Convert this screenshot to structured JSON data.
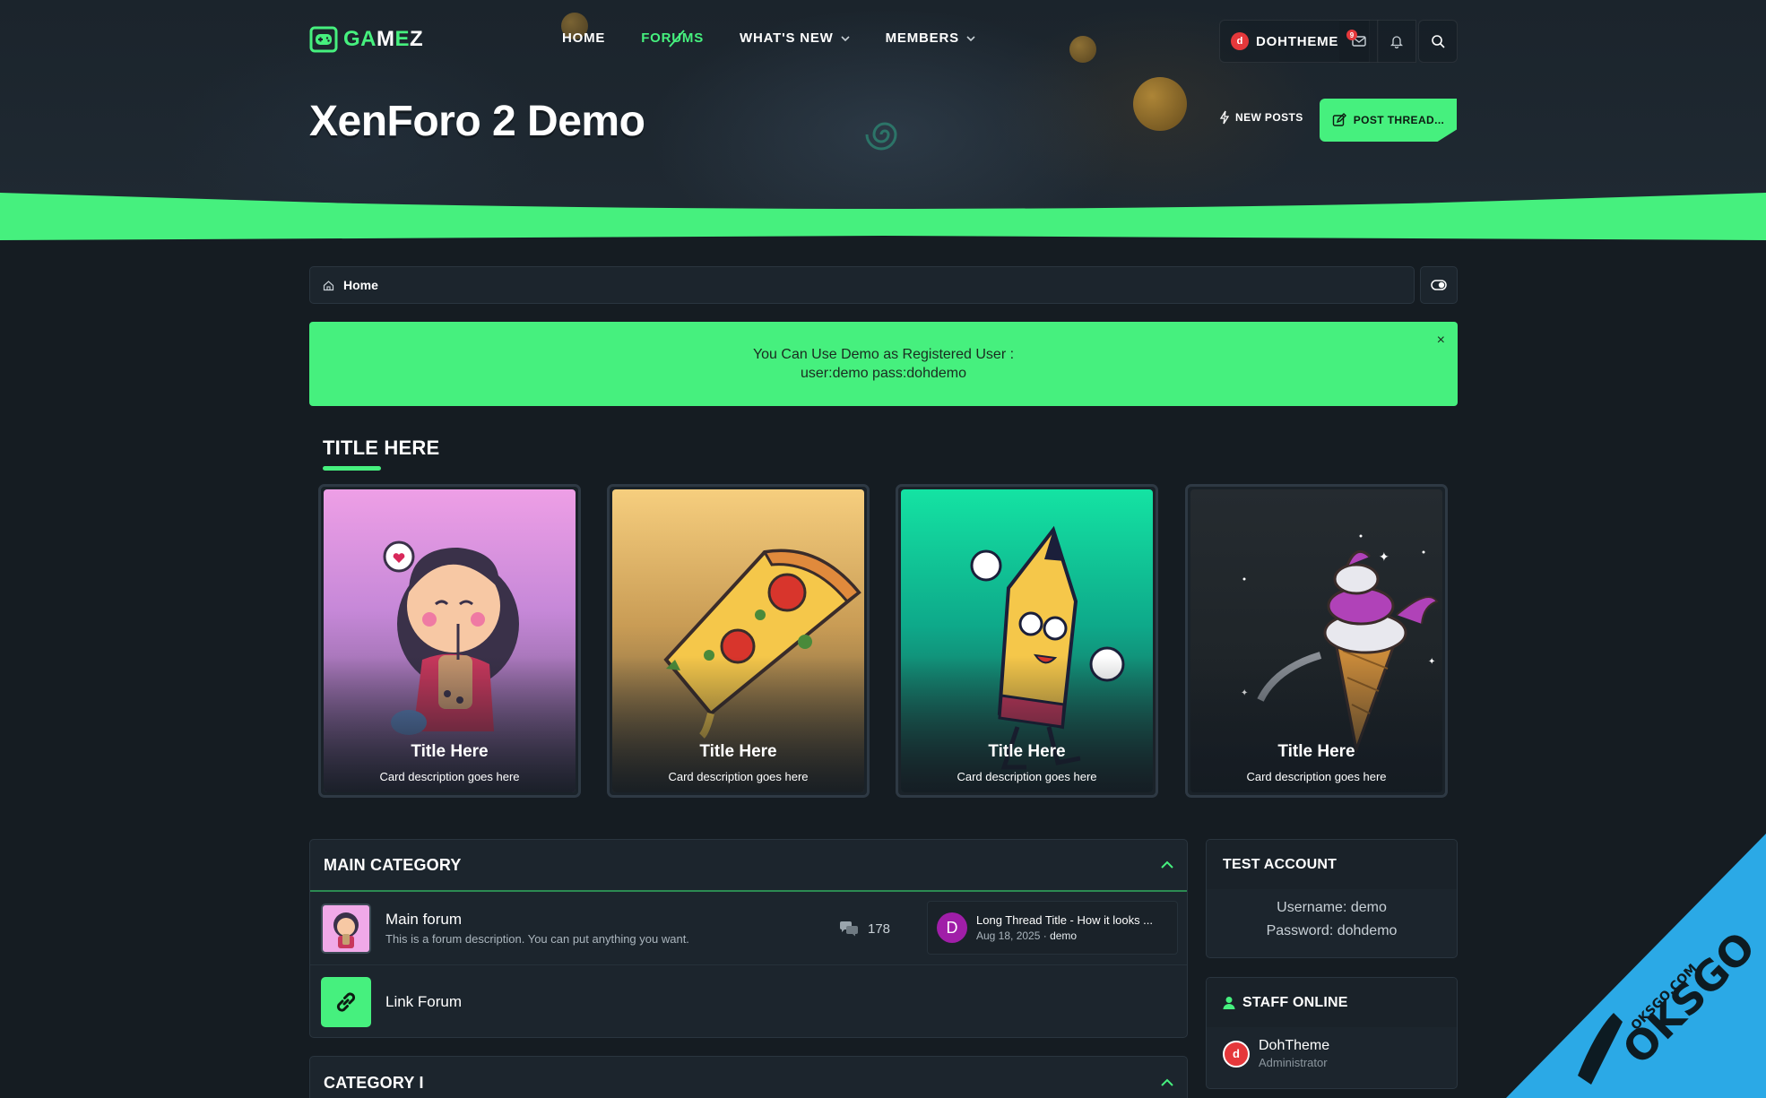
{
  "header": {
    "logo_text_green": "GA",
    "logo_text_white_1": "M",
    "logo_text_green_2": "E",
    "logo_text_white_2": "Z",
    "nav": [
      {
        "label": "HOME"
      },
      {
        "label": "FORUMS"
      },
      {
        "label": "WHAT'S NEW"
      },
      {
        "label": "MEMBERS"
      }
    ],
    "user_name": "DOHTHEME",
    "user_initial": "d",
    "inbox_badge": "9"
  },
  "hero": {
    "title": "XenForo 2 Demo",
    "new_posts_label": "NEW POSTS",
    "post_thread_label": "POST THREAD..."
  },
  "breadcrumb": {
    "label": "Home"
  },
  "notice": {
    "line1": "You Can Use Demo as Registered User :",
    "line2": "user:demo pass:dohdemo",
    "close": "×"
  },
  "featured": {
    "title": "TITLE HERE",
    "cards": [
      {
        "title": "Title Here",
        "desc": "Card description goes here"
      },
      {
        "title": "Title Here",
        "desc": "Card description goes here"
      },
      {
        "title": "Title Here",
        "desc": "Card description goes here"
      },
      {
        "title": "Title Here",
        "desc": "Card description goes here"
      }
    ]
  },
  "main_category": {
    "title": "MAIN CATEGORY",
    "nodes": [
      {
        "title": "Main forum",
        "desc": "This is a forum description. You can put anything you want.",
        "messages": "178",
        "last_title": "Long Thread Title - How it looks ...",
        "last_date": "Aug 18, 2025",
        "last_sep": " · ",
        "last_user": "demo",
        "last_avatar": "D"
      },
      {
        "title": "Link Forum"
      }
    ]
  },
  "category_1": {
    "title": "CATEGORY I"
  },
  "sidebar": {
    "test_account": {
      "title": "TEST ACCOUNT",
      "username": "Username: demo",
      "password": "Password: dohdemo"
    },
    "staff_online": {
      "title": "STAFF ONLINE",
      "members": [
        {
          "name": "DohTheme",
          "role": "Administrator",
          "initial": "d"
        }
      ]
    }
  },
  "watermark": {
    "text_small": "OKSGO.COM",
    "text_large": "OKSGO"
  },
  "colors": {
    "accent": "#46f07e",
    "background": "#151c22",
    "panel": "#1c252d",
    "alert": "#e5383b"
  },
  "icons": [
    "gamepad-icon",
    "chevron-down-icon",
    "envelope-icon",
    "bell-icon",
    "search-icon",
    "bolt-icon",
    "edit-icon",
    "home-icon",
    "toggle-icon",
    "close-icon",
    "chevron-up-icon",
    "comments-icon",
    "link-icon",
    "user-icon"
  ]
}
